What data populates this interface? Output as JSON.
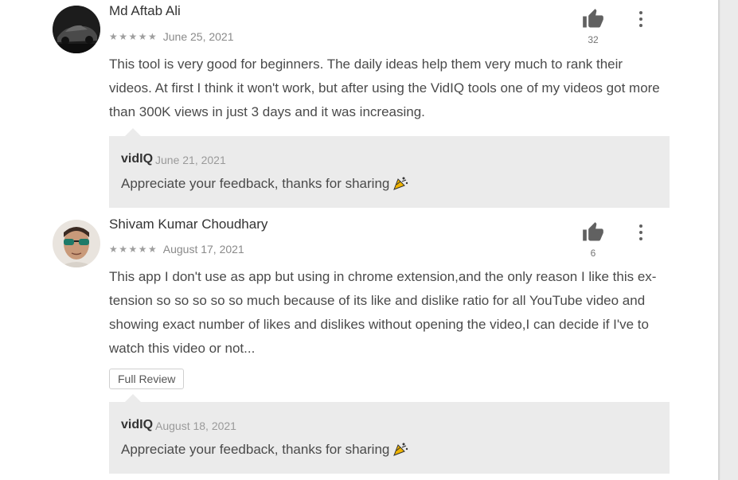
{
  "reviews": [
    {
      "author": "Md Aftab Ali",
      "stars": "★★★★★",
      "rating": 5,
      "date": "June 25, 2021",
      "helpful_count": "32",
      "text_lines": [
        "This tool is very good for beginners. The daily ideas help them very much to rank their",
        "videos. At first I think it won't work, but after using the VidIQ tools one of my videos got more",
        "than 300K views in just 3 days and it was increasing."
      ],
      "reply": {
        "developer": "vidIQ",
        "date": "June 21, 2021",
        "text": "Appreciate your feedback, thanks for sharing"
      }
    },
    {
      "author": "Shivam Kumar Choudhary",
      "stars": "★★★★★",
      "rating": 5,
      "date": "August 17, 2021",
      "helpful_count": "6",
      "text_lines": [
        "This app I don't use as app but using in chrome extension,and the only reason I like this ex-",
        "tension so so so so so much because of its like and dislike ratio for all YouTube video and",
        "showing exact number of likes and dislikes without opening the video,I can decide if I've to",
        "watch this video or not..."
      ],
      "full_review_label": "Full Review",
      "reply": {
        "developer": "vidIQ",
        "date": "August 18, 2021",
        "text": "Appreciate your feedback, thanks for sharing"
      }
    }
  ],
  "icons": {
    "helpful": "thumbs-up-icon",
    "menu": "more-vertical-icon",
    "reply_emoji": "party-popper-icon"
  },
  "colors": {
    "reply_background": "#ebebeb",
    "icon": "#616161",
    "text": "#4a4a4a"
  }
}
